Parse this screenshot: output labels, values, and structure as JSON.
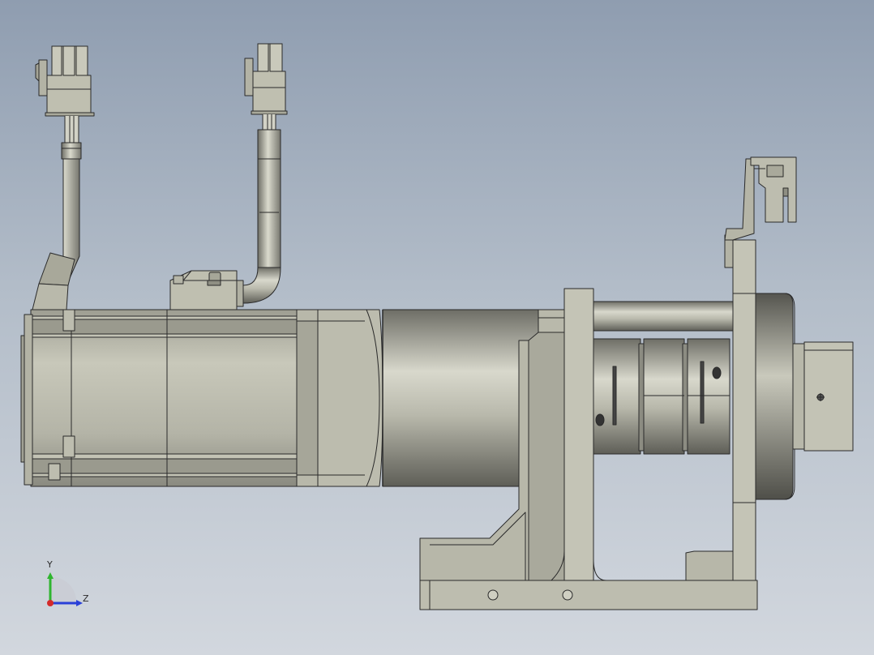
{
  "viewport": {
    "background_top": "#8f9db0",
    "background_bottom": "#d2d7de"
  },
  "model": {
    "part_fill": "#bfbfb0",
    "part_dark": "#9d9d90",
    "edge_color": "#2a2a2a",
    "cylinder_dark": "#6e6e66",
    "cylinder_light": "#d8d8cc"
  },
  "triad": {
    "y_label": "Y",
    "z_label": "Z",
    "y_color": "#2fb52f",
    "z_color": "#2a40d8",
    "x_color": "#d42a2a"
  }
}
